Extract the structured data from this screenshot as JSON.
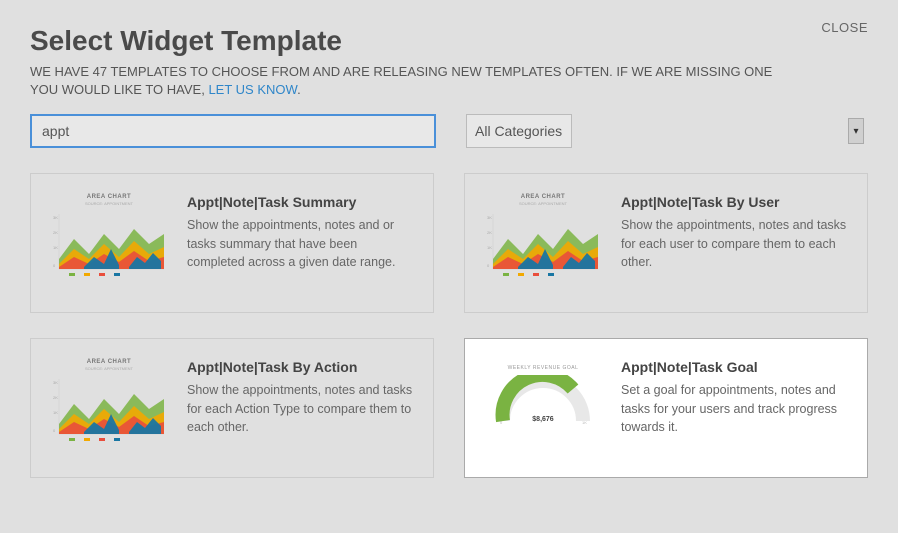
{
  "modal": {
    "close_label": "CLOSE"
  },
  "header": {
    "title": "Select Widget Template",
    "subtitle_part1": "WE HAVE 47 TEMPLATES TO CHOOSE FROM AND ARE RELEASING NEW TEMPLATES OFTEN. IF WE ARE MISSING ONE YOU WOULD LIKE TO HAVE, ",
    "subtitle_link": "LET US KNOW",
    "subtitle_part2": "."
  },
  "filters": {
    "search_value": "appt",
    "category_selected": "All Categories"
  },
  "thumb": {
    "area_title": "AREA CHART",
    "area_sub": "SOURCE: APPOINTMENT",
    "gauge_title": "WEEKLY REVENUE GOAL",
    "gauge_value": "$8,676"
  },
  "templates": [
    {
      "title": "Appt|Note|Task Summary",
      "desc": "Show the appointments, notes and or tasks summary that have been completed across a given date range.",
      "thumb_type": "area",
      "highlight": false
    },
    {
      "title": "Appt|Note|Task By User",
      "desc": "Show the appointments, notes and tasks for each user to compare them to each other.",
      "thumb_type": "area",
      "highlight": false
    },
    {
      "title": "Appt|Note|Task By Action",
      "desc": "Show the appointments, notes and tasks for each Action Type to compare them to each other.",
      "thumb_type": "area",
      "highlight": false
    },
    {
      "title": "Appt|Note|Task Goal",
      "desc": "Set a goal for appointments, notes and tasks for your users and track progress towards it.",
      "thumb_type": "gauge",
      "highlight": true
    }
  ]
}
